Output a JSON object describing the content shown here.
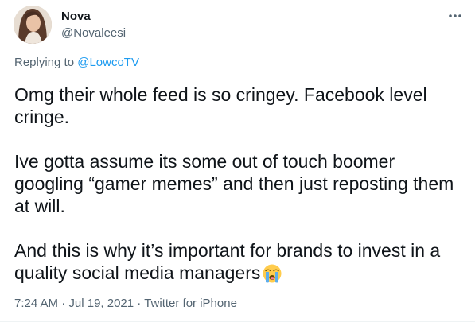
{
  "author": {
    "display_name": "Nova",
    "handle": "@Novaleesi",
    "avatar_icon": "profile-photo"
  },
  "reply": {
    "prefix": "Replying to",
    "mention": "@LowcoTV"
  },
  "body": {
    "p1": "Omg their whole feed is so cringey. Facebook level cringe.",
    "p2": "Ive gotta assume its some out of touch boomer googling “gamer memes” and then just reposting them at will.",
    "p3": "And this is why it’s important for brands to invest in a quality social media managers",
    "emoji": "loudly-crying-face"
  },
  "meta": {
    "time": "7:24 AM",
    "sep1": " · ",
    "date": "Jul 19, 2021",
    "sep2": " · ",
    "source": "Twitter for iPhone"
  },
  "colors": {
    "text": "#0f1419",
    "secondary": "#536471",
    "link": "#1d9bf0"
  }
}
